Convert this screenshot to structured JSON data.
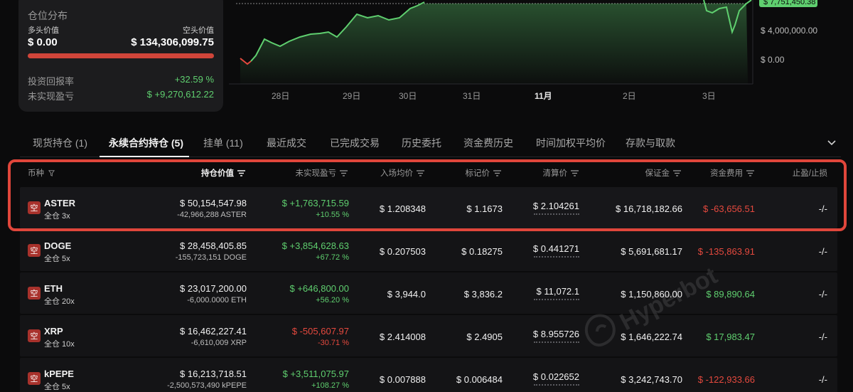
{
  "summary": {
    "title": "仓位分布",
    "long_label": "多头价值",
    "short_label": "空头价值",
    "long_value": "$ 0.00",
    "short_value": "$ 134,306,099.75",
    "roi_label": "投资回报率",
    "roi_value": "+32.59 %",
    "upnl_label": "未实现盈亏",
    "upnl_value": "$ +9,270,612.22"
  },
  "chart": {
    "price_tag": "$ 7,751,450.38",
    "y_labels": [
      "$ 4,000,000.00",
      "$ 0.00"
    ],
    "x_labels": [
      "28日",
      "29日",
      "30日",
      "31日",
      "11月",
      "2日",
      "3日"
    ],
    "line_color": "#5fcf6f",
    "negative_color": "#e5493e"
  },
  "tabs": [
    {
      "label": "现货持仓 (1)"
    },
    {
      "label": "永续合约持仓 (5)"
    },
    {
      "label": "挂单 (11)"
    },
    {
      "label": "最近成交"
    },
    {
      "label": "已完成交易"
    },
    {
      "label": "历史委托"
    },
    {
      "label": "资金费历史"
    },
    {
      "label": "时间加权平均价"
    },
    {
      "label": "存款与取款"
    }
  ],
  "columns": {
    "coin": "币种",
    "position_value": "持仓价值",
    "upnl": "未实现盈亏",
    "entry": "入场均价",
    "mark": "标记价",
    "liq": "清算价",
    "margin": "保证金",
    "funding": "资金费用",
    "tpsl": "止盈/止损"
  },
  "rows": [
    {
      "side_icon": "空",
      "coin": "ASTER",
      "leverage": "全仓 3x",
      "value": "$ 50,154,547.98",
      "size": "-42,966,288 ASTER",
      "upnl": "$ +1,763,715.59",
      "upnl_pct": "+10.55 %",
      "upnl_sign": "pos",
      "entry": "$ 1.208348",
      "mark": "$ 1.1673",
      "liq": "$ 2.104261",
      "margin": "$ 16,718,182.66",
      "funding": "$ -63,656.51",
      "funding_sign": "neg",
      "tpsl": "-/-"
    },
    {
      "side_icon": "空",
      "coin": "DOGE",
      "leverage": "全仓 5x",
      "value": "$ 28,458,405.85",
      "size": "-155,723,151 DOGE",
      "upnl": "$ +3,854,628.63",
      "upnl_pct": "+67.72 %",
      "upnl_sign": "pos",
      "entry": "$ 0.207503",
      "mark": "$ 0.18275",
      "liq": "$ 0.441271",
      "margin": "$ 5,691,681.17",
      "funding": "$ -135,863.91",
      "funding_sign": "neg",
      "tpsl": "-/-"
    },
    {
      "side_icon": "空",
      "coin": "ETH",
      "leverage": "全仓 20x",
      "value": "$ 23,017,200.00",
      "size": "-6,000.0000 ETH",
      "upnl": "$ +646,800.00",
      "upnl_pct": "+56.20 %",
      "upnl_sign": "pos",
      "entry": "$ 3,944.0",
      "mark": "$ 3,836.2",
      "liq": "$ 11,072.1",
      "margin": "$ 1,150,860.00",
      "funding": "$ 89,890.64",
      "funding_sign": "pos",
      "tpsl": "-/-"
    },
    {
      "side_icon": "空",
      "coin": "XRP",
      "leverage": "全仓 10x",
      "value": "$ 16,462,227.41",
      "size": "-6,610,009 XRP",
      "upnl": "$ -505,607.97",
      "upnl_pct": "-30.71 %",
      "upnl_sign": "neg",
      "entry": "$ 2.414008",
      "mark": "$ 2.4905",
      "liq": "$ 8.955726",
      "margin": "$ 1,646,222.74",
      "funding": "$ 17,983.47",
      "funding_sign": "pos",
      "tpsl": "-/-"
    },
    {
      "side_icon": "空",
      "coin": "kPEPE",
      "leverage": "全仓 5x",
      "value": "$ 16,213,718.51",
      "size": "-2,500,573,490 kPEPE",
      "upnl": "$ +3,511,075.97",
      "upnl_pct": "+108.27 %",
      "upnl_sign": "pos",
      "entry": "$ 0.007888",
      "mark": "$ 0.006484",
      "liq": "$ 0.022652",
      "margin": "$ 3,242,743.70",
      "funding": "$ -122,933.66",
      "funding_sign": "neg",
      "tpsl": "-/-"
    }
  ],
  "watermark": "Hyperbot"
}
